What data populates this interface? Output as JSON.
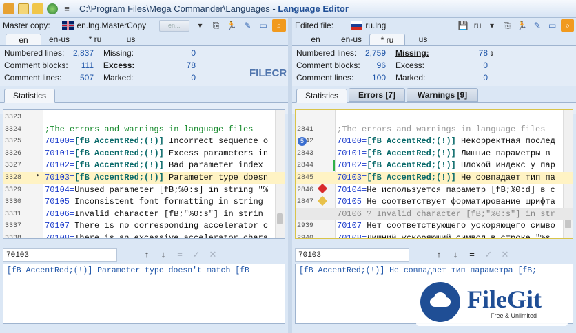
{
  "window": {
    "path": "C:\\Program Files\\Mega Commander\\Languages",
    "separator": " - ",
    "app_name": "Language Editor"
  },
  "left": {
    "file_label": "Master copy:",
    "file_name": "en.lng.MasterCopy",
    "combo_value": "en...",
    "tabs": [
      "en",
      "en-us",
      "* ru",
      "us"
    ],
    "stats": {
      "numbered_label": "Numbered lines:",
      "numbered": "2,837",
      "blocks_label": "Comment blocks:",
      "blocks": "111",
      "comment_label": "Comment lines:",
      "comment": "507",
      "missing_label": "Missing:",
      "missing": "0",
      "excess_label": "Excess:",
      "excess": "78",
      "marked_label": "Marked:",
      "marked": "0"
    },
    "bottom_tabs": [
      "Statistics"
    ],
    "lines": [
      {
        "n": "3323",
        "id": "",
        "tag": "",
        "text": ""
      },
      {
        "n": "3324",
        "id": "",
        "tag": "",
        "text": ";The errors and warnings in language files",
        "kind": "comment"
      },
      {
        "n": "3325",
        "id": "70100=",
        "tag": "[fB AccentRed;(!)]",
        "text": " Incorrect sequence o"
      },
      {
        "n": "3326",
        "id": "70101=",
        "tag": "[fB AccentRed;(!)]",
        "text": " Excess parameters in"
      },
      {
        "n": "3327",
        "id": "70102=",
        "tag": "[fB AccentRed;(!)]",
        "text": " Bad parameter index"
      },
      {
        "n": "3328",
        "id": "70103=",
        "tag": "[fB AccentRed;(!)]",
        "text": " Parameter type doesn",
        "current": true
      },
      {
        "n": "3329",
        "id": "70104=",
        "tag": "",
        "text": "Unused parameter [fB;%0:s] in string \"%"
      },
      {
        "n": "3330",
        "id": "70105=",
        "tag": "",
        "text": "Inconsistent font formatting in string"
      },
      {
        "n": "3331",
        "id": "70106=",
        "tag": "",
        "text": "Invalid character [fB;\"%0:s\"] in strin"
      },
      {
        "n": "3337",
        "id": "70107=",
        "tag": "",
        "text": "There is no corresponding accelerator c"
      },
      {
        "n": "3338",
        "id": "70108=",
        "tag": "",
        "text": "There is an excessive accelerator chara"
      }
    ],
    "find_value": "70103",
    "preview": "[fB AccentRed;(!)] Parameter type doesn't match [fB"
  },
  "right": {
    "file_label": "Edited file:",
    "file_name": "ru.lng",
    "combo_value": "ru",
    "tabs": [
      "en",
      "en-us",
      "* ru",
      "us"
    ],
    "stats": {
      "numbered_label": "Numbered lines:",
      "numbered": "2,759",
      "blocks_label": "Comment blocks:",
      "blocks": "96",
      "comment_label": "Comment lines:",
      "comment": "100",
      "missing_label": "Missing:",
      "missing": "78",
      "excess_label": "Excess:",
      "excess": "0",
      "marked_label": "Marked:",
      "marked": "0"
    },
    "bottom_tabs": [
      "Statistics",
      "Errors [7]",
      "Warnings [9]"
    ],
    "lines": [
      {
        "n": "",
        "id": "",
        "tag": "",
        "text": ""
      },
      {
        "n": "2841",
        "id": "",
        "tag": "",
        "text": ";The errors and warnings in language files",
        "kind": "comment-grey"
      },
      {
        "n": "2842",
        "id": "70100=",
        "tag": "[fB AccentRed;(!)]",
        "text": " Некорректная послед",
        "marker": "5"
      },
      {
        "n": "2843",
        "id": "70101=",
        "tag": "[fB AccentRed;(!)]",
        "text": " Лишние параметры в"
      },
      {
        "n": "2844",
        "id": "70102=",
        "tag": "[fB AccentRed;(!)]",
        "text": " Плохой индекс у пар"
      },
      {
        "n": "2845",
        "id": "70103=",
        "tag": "[fB AccentRed;(!)]",
        "text": " Не совпадает тип па",
        "current": true
      },
      {
        "n": "2846",
        "id": "70104=",
        "tag": "",
        "text": "Не используется параметр [fB;%0:d] в с"
      },
      {
        "n": "2847",
        "id": "70105=",
        "tag": "",
        "text": "Не соответствует форматирование шрифта"
      },
      {
        "n": "",
        "id": "",
        "tag": "",
        "text": "70106 ? Invalid character [fB;\"%0:s\"] in str",
        "kind": "missing"
      },
      {
        "n": "2939",
        "id": "70107=",
        "tag": "",
        "text": "Нет соответствующего ускоряющего симво"
      },
      {
        "n": "2940",
        "id": "70108=",
        "tag": "",
        "text": "Лишний ускоряющий символ в строке \"%s"
      }
    ],
    "find_value": "70103",
    "preview": "[fB AccentRed;(!)] Не совпадает тип параметра [fB;"
  },
  "find_buttons": [
    "↑",
    "↓",
    "=",
    "✓",
    "✕"
  ],
  "watermarks": {
    "center": "FILECR",
    "brand": "FileGit",
    "tagline": "Free & Unlimited"
  },
  "colors": {
    "accent": "#1f55a8",
    "current_line": "#fff3c4",
    "comment": "#178a2d",
    "error_marker": "#d92b2b",
    "warning_marker": "#e8c14a"
  }
}
